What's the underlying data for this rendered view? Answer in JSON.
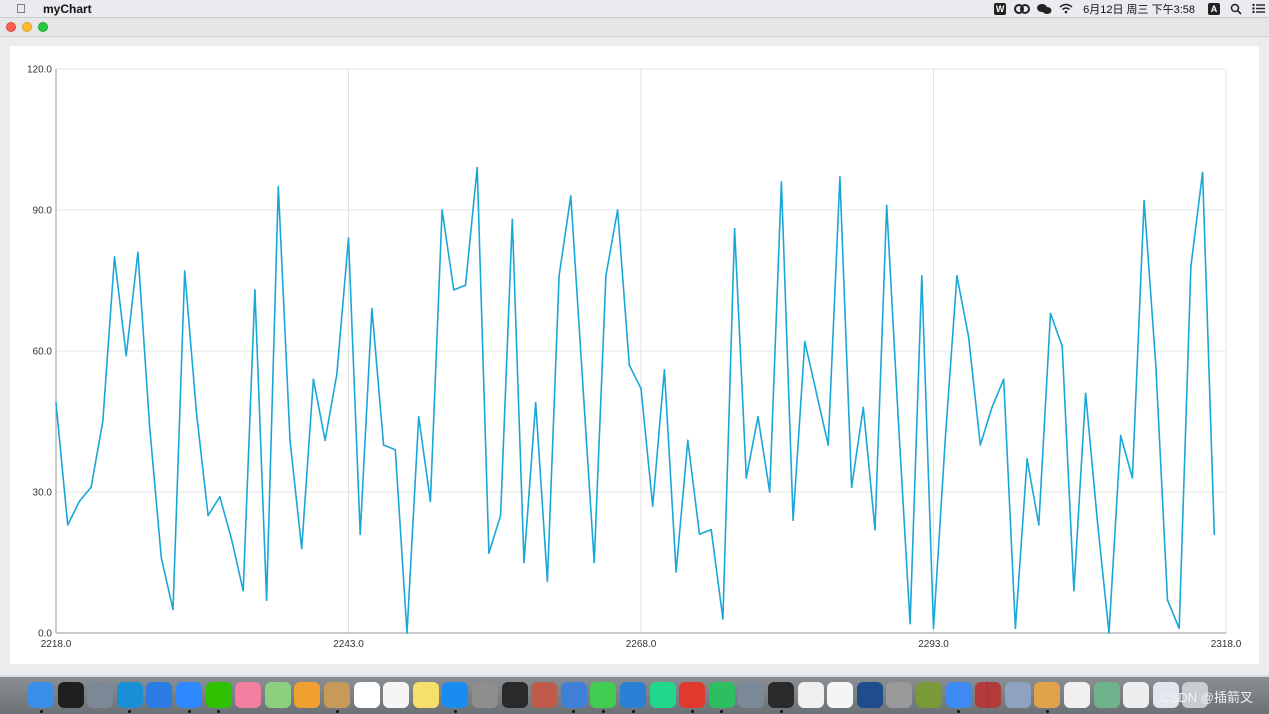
{
  "menubar": {
    "app_name": "myChart",
    "datetime": "6月12日 周三 下午3:58",
    "tray_icons": [
      "wps-icon",
      "baidu-netdisk-icon",
      "wechat-icon",
      "wifi-icon"
    ],
    "input_method": "A"
  },
  "window": {
    "title": ""
  },
  "chart_data": {
    "type": "line",
    "title": "",
    "xlabel": "",
    "ylabel": "",
    "xlim": [
      2218,
      2318
    ],
    "ylim": [
      0,
      120
    ],
    "x_ticks": [
      "2218.0",
      "2243.0",
      "2268.0",
      "2293.0",
      "2318.0"
    ],
    "y_ticks": [
      "0.0",
      "30.0",
      "60.0",
      "90.0",
      "120.0"
    ],
    "grid": true,
    "color": "#1aa7d8",
    "x": [
      2218,
      2219,
      2220,
      2221,
      2222,
      2223,
      2224,
      2225,
      2226,
      2227,
      2228,
      2229,
      2230,
      2231,
      2232,
      2233,
      2234,
      2235,
      2236,
      2237,
      2238,
      2239,
      2240,
      2241,
      2242,
      2243,
      2244,
      2245,
      2246,
      2247,
      2248,
      2249,
      2250,
      2251,
      2252,
      2253,
      2254,
      2255,
      2256,
      2257,
      2258,
      2259,
      2260,
      2261,
      2262,
      2263,
      2264,
      2265,
      2266,
      2267,
      2268,
      2269,
      2270,
      2271,
      2272,
      2273,
      2274,
      2275,
      2276,
      2277,
      2278,
      2279,
      2280,
      2281,
      2282,
      2283,
      2284,
      2285,
      2286,
      2287,
      2288,
      2289,
      2290,
      2291,
      2292,
      2293,
      2294,
      2295,
      2296,
      2297,
      2298,
      2299,
      2300,
      2301,
      2302,
      2303,
      2304,
      2305,
      2306,
      2307,
      2308,
      2309,
      2310,
      2311,
      2312,
      2313,
      2314,
      2315,
      2316,
      2317
    ],
    "values": [
      49,
      23,
      28,
      31,
      45,
      80,
      59,
      81,
      44,
      16,
      5,
      77,
      47,
      25,
      29,
      20,
      9,
      73,
      7,
      95,
      41,
      18,
      54,
      41,
      55,
      84,
      21,
      69,
      40,
      39,
      0,
      46,
      28,
      90,
      73,
      74,
      99,
      17,
      25,
      88,
      15,
      49,
      11,
      76,
      93,
      54,
      15,
      76,
      90,
      57,
      52,
      27,
      56,
      13,
      41,
      21,
      22,
      3,
      86,
      33,
      46,
      30,
      96,
      24,
      62,
      51,
      40,
      97,
      31,
      48,
      22,
      91,
      45,
      2,
      76,
      1,
      41,
      76,
      63,
      40,
      48,
      54,
      1,
      37,
      23,
      68,
      61,
      9,
      51,
      24,
      0,
      42,
      33,
      92,
      57,
      7,
      1,
      78,
      98,
      21
    ]
  },
  "dock": {
    "icons": [
      {
        "name": "finder-icon",
        "color": "#3b8ee8"
      },
      {
        "name": "terminal-icon",
        "color": "#1f1f1f"
      },
      {
        "name": "launchpad-icon",
        "color": "#7d8896"
      },
      {
        "name": "edge-icon",
        "color": "#1b8fd6"
      },
      {
        "name": "safari-icon",
        "color": "#2c7be5"
      },
      {
        "name": "feishu-icon",
        "color": "#2f88ff"
      },
      {
        "name": "wechat-icon",
        "color": "#2dc100"
      },
      {
        "name": "bilibili-icon",
        "color": "#f27fa0"
      },
      {
        "name": "maps-icon",
        "color": "#8ccf7e"
      },
      {
        "name": "photos-icon",
        "color": "#f0a030"
      },
      {
        "name": "notes-book-icon",
        "color": "#c89a5a"
      },
      {
        "name": "calendar-icon",
        "color": "#ffffff"
      },
      {
        "name": "reminders-icon",
        "color": "#f5f5f5"
      },
      {
        "name": "stickies-icon",
        "color": "#f6e06a"
      },
      {
        "name": "app-store-icon",
        "color": "#1a8cf0"
      },
      {
        "name": "system-preferences-icon",
        "color": "#8e8e8e"
      },
      {
        "name": "console-icon",
        "color": "#2a2a2a"
      },
      {
        "name": "portrait-app-icon",
        "color": "#c05a4a"
      },
      {
        "name": "xcode-icon",
        "color": "#3f7fd8"
      },
      {
        "name": "qt-creator-icon",
        "color": "#41cd52"
      },
      {
        "name": "vscode-icon",
        "color": "#2b7fd4"
      },
      {
        "name": "pycharm-icon",
        "color": "#21d789"
      },
      {
        "name": "wps-icon",
        "color": "#e03a2f"
      },
      {
        "name": "evernote-icon",
        "color": "#2dbe60"
      },
      {
        "name": "texshop-icon",
        "color": "#7a8a99"
      },
      {
        "name": "m-app-icon",
        "color": "#2b2b2b"
      },
      {
        "name": "pen-icon",
        "color": "#efefef"
      },
      {
        "name": "mathtype-icon",
        "color": "#f5f5f5"
      },
      {
        "name": "triangle-app-icon",
        "color": "#1e4c8c"
      },
      {
        "name": "brain-icon",
        "color": "#9a9a9a"
      },
      {
        "name": "leaf-icon",
        "color": "#7a9a3a"
      },
      {
        "name": "baidu-netdisk-icon",
        "color": "#3d8bf2"
      },
      {
        "name": "dictionary-icon",
        "color": "#b23a3a"
      },
      {
        "name": "preview-icon",
        "color": "#8fa3c0"
      },
      {
        "name": "archive-icon",
        "color": "#e0a24a"
      },
      {
        "name": "textedit-icon",
        "color": "#f0f0f0"
      },
      {
        "name": "chatgpt-icon",
        "color": "#6fb38c"
      },
      {
        "name": "document-icon",
        "color": "#eeeeee"
      },
      {
        "name": "folder-icon",
        "color": "#dfe6ee"
      },
      {
        "name": "trash-icon",
        "color": "#c9cdd2"
      }
    ],
    "watermark": "CSDN @插箭叉"
  }
}
